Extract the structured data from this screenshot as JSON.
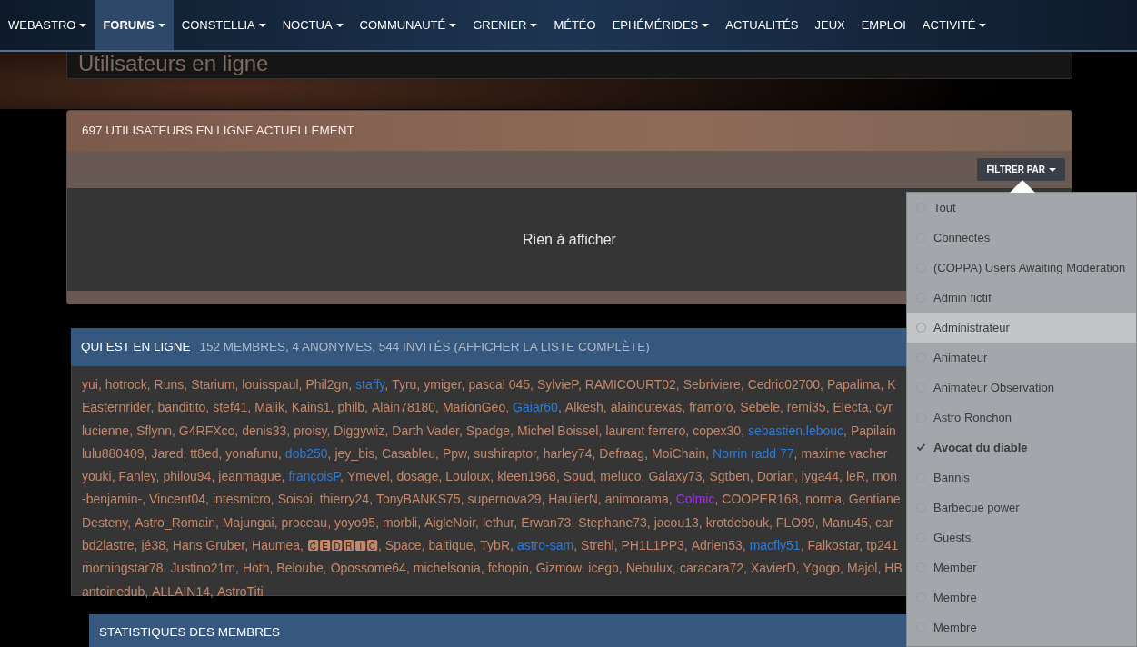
{
  "navbar": {
    "items": [
      {
        "label": "WEBASTRO",
        "has_menu": true,
        "selected": false
      },
      {
        "label": "FORUMS",
        "has_menu": true,
        "selected": true
      },
      {
        "label": "CONSTELLIA",
        "has_menu": true,
        "selected": false
      },
      {
        "label": "NOCTUA",
        "has_menu": true,
        "selected": false
      },
      {
        "label": "COMMUNAUTÉ",
        "has_menu": true,
        "selected": false
      },
      {
        "label": "GRENIER",
        "has_menu": true,
        "selected": false
      },
      {
        "label": "MÉTÉO",
        "has_menu": false,
        "selected": false
      },
      {
        "label": "EPHÉMÉRIDES",
        "has_menu": true,
        "selected": false
      },
      {
        "label": "ACTUALITÉS",
        "has_menu": false,
        "selected": false
      },
      {
        "label": "JEUX",
        "has_menu": false,
        "selected": false
      },
      {
        "label": "EMPLOI",
        "has_menu": false,
        "selected": false
      },
      {
        "label": "ACTIVITÉ",
        "has_menu": true,
        "selected": false
      }
    ]
  },
  "page_title": "Utilisateurs en ligne",
  "online_panel": {
    "title": "697 UTILISATEURS EN LIGNE ACTUELLEMENT",
    "filter_button": "FILTRER PAR",
    "empty_message": "Rien à afficher"
  },
  "filter_menu": {
    "items": [
      {
        "label": "Tout",
        "checked": false,
        "hovered": false
      },
      {
        "label": "Connectés",
        "checked": false,
        "hovered": false
      },
      {
        "label": "(COPPA) Users Awaiting Moderation",
        "checked": false,
        "hovered": false
      },
      {
        "label": "Admin fictif",
        "checked": false,
        "hovered": false
      },
      {
        "label": "Administrateur",
        "checked": false,
        "hovered": true
      },
      {
        "label": "Animateur",
        "checked": false,
        "hovered": false
      },
      {
        "label": "Animateur Observation",
        "checked": false,
        "hovered": false
      },
      {
        "label": "Astro Ronchon",
        "checked": false,
        "hovered": false
      },
      {
        "label": "Avocat du diable",
        "checked": true,
        "hovered": false
      },
      {
        "label": "Bannis",
        "checked": false,
        "hovered": false
      },
      {
        "label": "Barbecue power",
        "checked": false,
        "hovered": false
      },
      {
        "label": "Guests",
        "checked": false,
        "hovered": false
      },
      {
        "label": "Member",
        "checked": false,
        "hovered": false
      },
      {
        "label": "Membre",
        "checked": false,
        "hovered": false
      },
      {
        "label": "Membre",
        "checked": false,
        "hovered": false
      }
    ]
  },
  "who_is_online": {
    "title": "QUI EST EN LIGNE",
    "separator": ",",
    "summary": "152 MEMBRES, 4 ANONYMES, 544 INVITÉS (AFFICHER LA LISTE COMPLÈTE)",
    "lines": [
      [
        {
          "name": "yui"
        },
        {
          "name": "hotrock"
        },
        {
          "name": "Runs"
        },
        {
          "name": "Starium"
        },
        {
          "name": "louisspaul"
        },
        {
          "name": "Phil2gn"
        },
        {
          "name": "staffy",
          "color": "#2c7bd6"
        },
        {
          "name": "Tyru"
        },
        {
          "name": "ymiger"
        },
        {
          "name": "pascal 045"
        },
        {
          "name": "SylvieP"
        },
        {
          "name": "RAMICOURT02"
        },
        {
          "name": "Sebriviere"
        },
        {
          "name": "Cedric02700"
        },
        {
          "name": "Papalima"
        },
        {
          "name": "K"
        }
      ],
      [
        {
          "name": "Easternrider"
        },
        {
          "name": "banditito"
        },
        {
          "name": "stef41"
        },
        {
          "name": "Malik"
        },
        {
          "name": "Kains1"
        },
        {
          "name": "philb"
        },
        {
          "name": "Alain78180"
        },
        {
          "name": "MarionGeo"
        },
        {
          "name": "Gaiar60",
          "color": "#2c7bd6"
        },
        {
          "name": "Alkesh"
        },
        {
          "name": "alaindutexas"
        },
        {
          "name": "framoro"
        },
        {
          "name": "Sebele"
        },
        {
          "name": "remi35"
        },
        {
          "name": "Electa"
        },
        {
          "name": "cyr"
        }
      ],
      [
        {
          "name": "lucienne"
        },
        {
          "name": "Sflynn"
        },
        {
          "name": "G4RFXco"
        },
        {
          "name": "denis33"
        },
        {
          "name": "proisy"
        },
        {
          "name": "Diggywiz"
        },
        {
          "name": "Darth Vader"
        },
        {
          "name": "Spadge"
        },
        {
          "name": "Michel Boissel"
        },
        {
          "name": "laurent ferrero"
        },
        {
          "name": "copex30"
        },
        {
          "name": "sebastien.lebouc",
          "color": "#2c7bd6"
        },
        {
          "name": "Papilain"
        }
      ],
      [
        {
          "name": "lulu880409"
        },
        {
          "name": "Jared"
        },
        {
          "name": "tt8ed"
        },
        {
          "name": "yonafunu"
        },
        {
          "name": "dob250",
          "color": "#2c7bd6"
        },
        {
          "name": "jey_bis"
        },
        {
          "name": "Casableu"
        },
        {
          "name": "Ppw"
        },
        {
          "name": "sushiraptor"
        },
        {
          "name": "harley74"
        },
        {
          "name": "Defraag"
        },
        {
          "name": "MoiChain"
        },
        {
          "name": "Norrin radd 77",
          "color": "#2c7bd6"
        },
        {
          "name": "maxime vacher"
        }
      ],
      [
        {
          "name": "youki"
        },
        {
          "name": "Fanley"
        },
        {
          "name": "philou94"
        },
        {
          "name": "jeanmague"
        },
        {
          "name": "françoisP",
          "color": "#2c7bd6"
        },
        {
          "name": "Ymevel"
        },
        {
          "name": "dosage"
        },
        {
          "name": "Louloux"
        },
        {
          "name": "kleen1968"
        },
        {
          "name": "Spud"
        },
        {
          "name": "meluco"
        },
        {
          "name": "Galaxy73"
        },
        {
          "name": "Sgtben"
        },
        {
          "name": "Dorian"
        },
        {
          "name": "jyga44"
        },
        {
          "name": "leR"
        },
        {
          "name": "mon"
        }
      ],
      [
        {
          "name": "-benjamin-"
        },
        {
          "name": "Vincent04"
        },
        {
          "name": "intesmicro"
        },
        {
          "name": "Soisoi"
        },
        {
          "name": "thierry24"
        },
        {
          "name": "TonyBANKS75"
        },
        {
          "name": "supernova29"
        },
        {
          "name": "HaulierN"
        },
        {
          "name": "animorama"
        },
        {
          "name": "Colmic",
          "color": "#9b32e6"
        },
        {
          "name": "COOPER168"
        },
        {
          "name": "norma"
        },
        {
          "name": "Gentiane"
        }
      ],
      [
        {
          "name": "Desteny"
        },
        {
          "name": "Astro_Romain"
        },
        {
          "name": "Majungai"
        },
        {
          "name": "proceau"
        },
        {
          "name": "yoyo95"
        },
        {
          "name": "morbli"
        },
        {
          "name": "AigleNoir"
        },
        {
          "name": "lethur"
        },
        {
          "name": "Erwan73"
        },
        {
          "name": "Stephane73"
        },
        {
          "name": "jacou13"
        },
        {
          "name": "krotdebouk"
        },
        {
          "name": "FLO99"
        },
        {
          "name": "Manu45"
        },
        {
          "name": "car"
        }
      ],
      [
        {
          "name": "bd2lastre"
        },
        {
          "name": "jé38"
        },
        {
          "name": "Hans Gruber"
        },
        {
          "name": "Haumea"
        },
        {
          "name": "🅲🅴🅳🆁🅸🅲"
        },
        {
          "name": "Space"
        },
        {
          "name": "baltique"
        },
        {
          "name": "TybR"
        },
        {
          "name": "astro-sam",
          "color": "#2c7bd6"
        },
        {
          "name": "Strehl"
        },
        {
          "name": "PH1L1PP3"
        },
        {
          "name": "Adrien53"
        },
        {
          "name": "macfly51",
          "color": "#2c7bd6"
        },
        {
          "name": "Falkostar"
        },
        {
          "name": "tp241"
        }
      ],
      [
        {
          "name": "morningstar78"
        },
        {
          "name": "Justino21m"
        },
        {
          "name": "Hoth"
        },
        {
          "name": "Beloube"
        },
        {
          "name": "Opossome64"
        },
        {
          "name": "michelsonia"
        },
        {
          "name": "fchopin"
        },
        {
          "name": "Gizmow"
        },
        {
          "name": "icegb"
        },
        {
          "name": "Nebulux"
        },
        {
          "name": "caracara72"
        },
        {
          "name": "XavierD"
        },
        {
          "name": "Ygogo"
        },
        {
          "name": "Majol"
        },
        {
          "name": "HB"
        }
      ],
      [
        {
          "name": "antoinedub"
        },
        {
          "name": "ALLAIN14"
        },
        {
          "name": "AstroTiti"
        }
      ]
    ]
  },
  "stats_panel": {
    "title": "STATISTIQUES DES MEMBRES"
  }
}
